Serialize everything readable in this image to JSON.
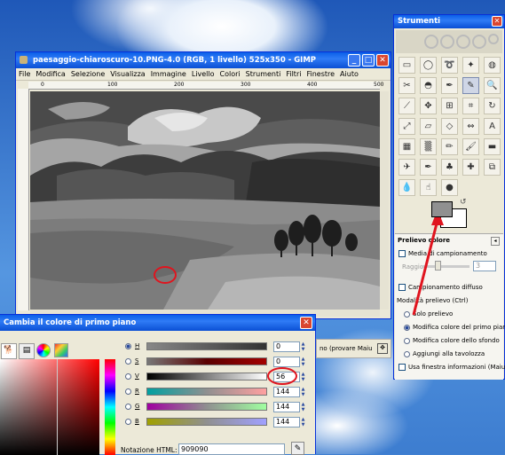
{
  "gimp_window": {
    "title": "paesaggio-chiaroscuro-10.PNG-4.0 (RGB, 1 livello) 525x350 - GIMP",
    "menu": [
      "File",
      "Modifica",
      "Selezione",
      "Visualizza",
      "Immagine",
      "Livello",
      "Colori",
      "Strumenti",
      "Filtri",
      "Finestre",
      "Aiuto"
    ],
    "ruler_marks": [
      "0",
      "100",
      "200",
      "300",
      "400",
      "500"
    ],
    "status_text": "no (provare Maiu"
  },
  "toolbox": {
    "title": "Strumenti",
    "tools": [
      "rect-select",
      "ellipse-select",
      "free-select",
      "fuzzy-select",
      "select-by-color",
      "scissors",
      "foreground-select",
      "paths",
      "color-picker",
      "zoom",
      "measure",
      "move",
      "align",
      "crop",
      "rotate",
      "scale",
      "shear",
      "perspective",
      "flip",
      "text",
      "bucket-fill",
      "blend",
      "pencil",
      "paintbrush",
      "eraser",
      "airbrush",
      "ink",
      "clone",
      "heal",
      "perspective-clone",
      "blur",
      "smudge",
      "dodge"
    ],
    "section_title": "Prelievo colore",
    "options": {
      "media_campionamento": "Media di campionamento",
      "raggio_label": "Raggio",
      "raggio_value": "3",
      "campionamento_diffuso": "Campionamento diffuso",
      "modalita_label": "Modalità prelievo  (Ctrl)",
      "modes": [
        "Solo prelievo",
        "Modifica colore del primo piano",
        "Modifica colore dello sfondo",
        "Aggiungi alla tavolozza"
      ],
      "selected_mode": 1,
      "usa_finestra": "Usa finestra informazioni  (Maiusc)"
    }
  },
  "color_dialog": {
    "title": "Cambia il colore di primo piano",
    "channels": [
      {
        "label": "H",
        "value": "0",
        "selected": true
      },
      {
        "label": "S",
        "value": "0",
        "selected": false
      },
      {
        "label": "V",
        "value": "56",
        "selected": false
      },
      {
        "label": "R",
        "value": "144",
        "selected": false
      },
      {
        "label": "G",
        "value": "144",
        "selected": false
      },
      {
        "label": "B",
        "value": "144",
        "selected": false
      }
    ],
    "html_label": "Notazione HTML:",
    "html_value": "909090"
  },
  "colors": {
    "foreground": "#909090",
    "background": "#ffffff",
    "annotation": "#e0141e"
  }
}
